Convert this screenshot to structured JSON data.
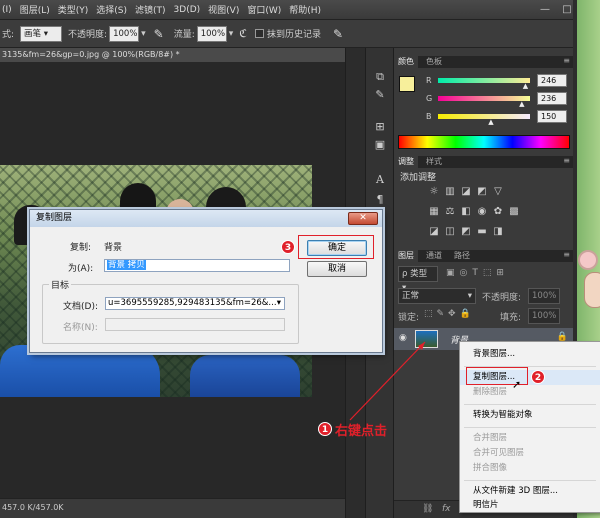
{
  "menubar": {
    "items": [
      "(I)",
      "图层(L)",
      "类型(Y)",
      "选择(S)",
      "滤镜(T)",
      "3D(D)",
      "视图(V)",
      "窗口(W)",
      "帮助(H)"
    ],
    "window_buttons": [
      "—",
      "□",
      "✕"
    ]
  },
  "options": {
    "prefix": "式:",
    "mode_value": "画笔",
    "opacity_label": "不透明度:",
    "opacity_value": "100%",
    "flow_label": "流量:",
    "flow_value": "100%",
    "history_label": "抹到历史记录"
  },
  "document": {
    "tab_title": "3135&fm=26&gp=0.jpg @ 100%(RGB/8#) *",
    "status": "457.0 K/457.0K"
  },
  "color_panel": {
    "tabs": [
      "颜色",
      "色板"
    ],
    "foreground": "#f7ef9b",
    "channels": [
      {
        "label": "R",
        "value": "246",
        "fraction": 0.965
      },
      {
        "label": "G",
        "value": "236",
        "fraction": 0.925
      },
      {
        "label": "B",
        "value": "150",
        "fraction": 0.59
      }
    ]
  },
  "adjust_panel": {
    "tabs": [
      "调整",
      "样式"
    ],
    "title": "添加调整"
  },
  "layers_panel": {
    "tabs": [
      "图层",
      "通道",
      "路径"
    ],
    "filter_label": "ρ 类型",
    "blend_mode": "正常",
    "opacity_label": "不透明度:",
    "opacity_value": "100%",
    "lock_label": "锁定:",
    "fill_label": "填充:",
    "fill_value": "100%",
    "layer_name": "背景"
  },
  "dialog": {
    "title": "复制图层",
    "copy_label": "复制:",
    "copy_value": "背景",
    "as_label": "为(A):",
    "as_value": "背景 拷贝",
    "ok_label": "确定",
    "cancel_label": "取消",
    "target_legend": "目标",
    "document_label": "文档(D):",
    "document_value": "u=3695559285,929483135&fm=26&...",
    "name_label": "名称(N):"
  },
  "context_menu": {
    "items": [
      {
        "label": "背景图层...",
        "disabled": false
      },
      {
        "label": "复制图层...",
        "disabled": false
      },
      {
        "label": "删除图层",
        "disabled": true
      },
      {
        "label": "转换为智能对象",
        "disabled": false
      },
      {
        "label": "合并图层",
        "disabled": true
      },
      {
        "label": "合并可见图层",
        "disabled": true
      },
      {
        "label": "拼合图像",
        "disabled": true
      },
      {
        "label": "从文件新建 3D 图层...",
        "disabled": false
      },
      {
        "label": "明信片",
        "disabled": false
      }
    ]
  },
  "annotations": {
    "step1": "1",
    "step1_text": "右键点击",
    "step2": "2",
    "step3": "3",
    "accent": "#e0202a"
  }
}
